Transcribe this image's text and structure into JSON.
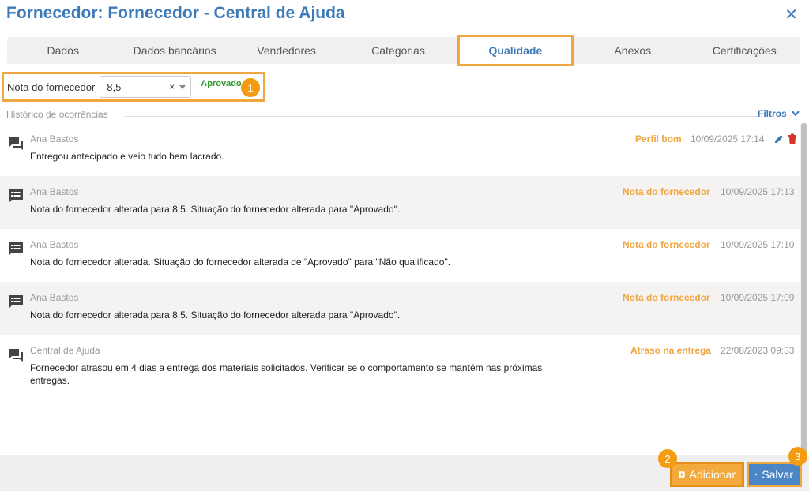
{
  "header": {
    "title": "Fornecedor: Fornecedor - Central de Ajuda",
    "close_glyph": "✕"
  },
  "tabs": [
    {
      "label": "Dados"
    },
    {
      "label": "Dados bancários"
    },
    {
      "label": "Vendedores"
    },
    {
      "label": "Categorias"
    },
    {
      "label": "Qualidade",
      "active": true
    },
    {
      "label": "Anexos"
    },
    {
      "label": "Certificações"
    }
  ],
  "nota": {
    "label": "Nota do fornecedor",
    "value": "8,5",
    "clear_glyph": "×",
    "status": "Aprovado"
  },
  "markers": {
    "one": "1",
    "two": "2",
    "three": "3"
  },
  "history": {
    "title": "Histórico de ocorrências",
    "filters_label": "Filtros",
    "filters_icon": "chevron-down-icon",
    "entries": [
      {
        "author": "Ana Bastos",
        "text": "Entregou antecipado e veio tudo bem lacrado.",
        "tag": "Perfil bom",
        "date": "10/09/2025 17:14",
        "icon": "comment-icon"
      },
      {
        "author": "Ana Bastos",
        "text": "Nota do fornecedor alterada para 8,5. Situação do fornecedor alterada para \"Aprovado\".",
        "tag": "Nota do fornecedor",
        "date": "10/09/2025 17:13",
        "icon": "list-note-icon"
      },
      {
        "author": "Ana Bastos",
        "text": "Nota do fornecedor alterada. Situação do fornecedor alterada de \"Aprovado\" para \"Não qualificado\".",
        "tag": "Nota do fornecedor",
        "date": "10/09/2025 17:10",
        "icon": "list-note-icon"
      },
      {
        "author": "Ana Bastos",
        "text": "Nota do fornecedor alterada para 8,5. Situação do fornecedor alterada para \"Aprovado\".",
        "tag": "Nota do fornecedor",
        "date": "10/09/2025 17:09",
        "icon": "list-note-icon"
      },
      {
        "author": "Central de Ajuda",
        "text": "Fornecedor atrasou em 4 dias a entrega dos materiais solicitados. Verificar se o comportamento se mantêm nas próximas entregas.",
        "tag": "Atraso na entrega",
        "date": "22/08/2023 09:33",
        "icon": "comment-icon"
      }
    ]
  },
  "footer": {
    "add_label": "Adicionar",
    "save_label": "Salvar"
  },
  "colors": {
    "primary": "#3d7ab8",
    "highlight": "#f0a742",
    "approved": "#2e9a2e",
    "delete": "#d9342b"
  }
}
